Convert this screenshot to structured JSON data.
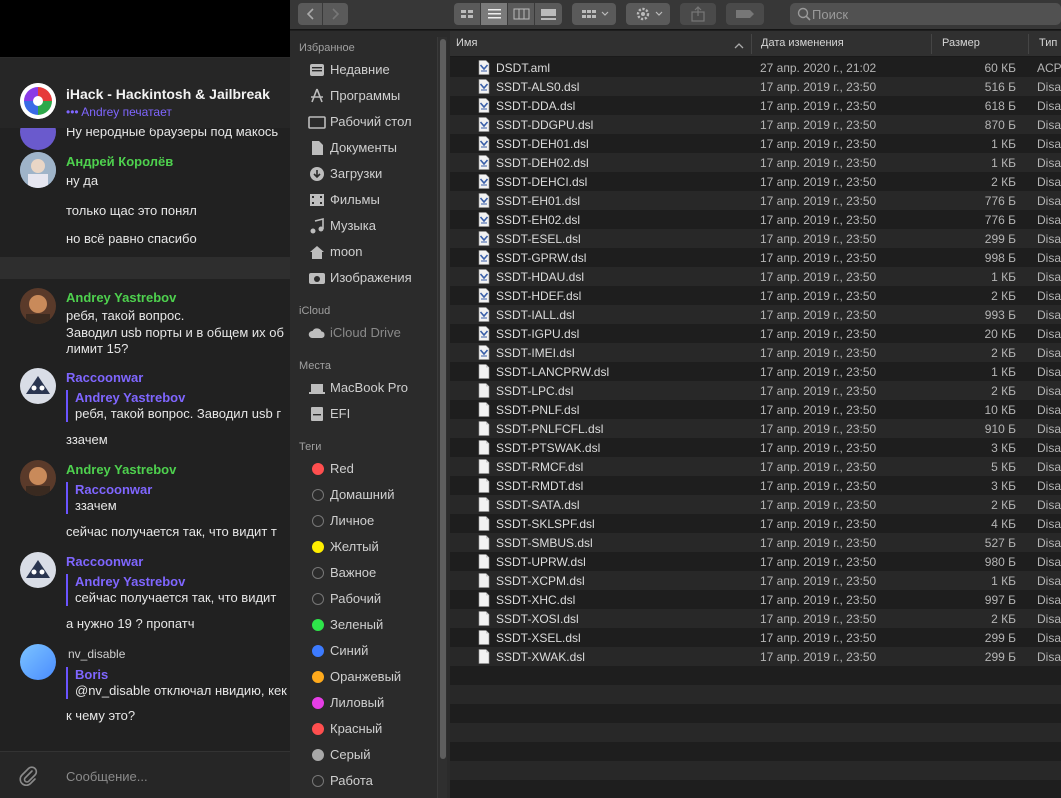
{
  "telegram": {
    "chat_title": "iHack - Hackintosh & Jailbreak",
    "typing_status": "Andrey печатает",
    "input_placeholder": "Сообщение...",
    "colors": {
      "accent": "#7f66ff",
      "green_name": "#4ed14e"
    },
    "messages": {
      "m0_text": "Ну неродные браузеры под макось",
      "m1_name": "Андрей Королёв",
      "m1_text1": "ну да",
      "m1_text2": "только щас это понял",
      "m1_text3": "но всё равно спасибо",
      "m2_name": "Andrey Yastrebov",
      "m2_text1": "ребя, такой вопрос.",
      "m2_text2": "Заводил usb порты и в общем их об",
      "m2_text3": "лимит 15?",
      "m3_name": "Raccoonwar",
      "m3_quote_name": "Andrey Yastrebov",
      "m3_quote_text": "ребя, такой вопрос. Заводил usb г",
      "m3_text": "ззачем",
      "m4_name": "Andrey Yastrebov",
      "m4_quote_name": "Raccoonwar",
      "m4_quote_text": "ззачем",
      "m4_text": "сейчас получается так, что видит т",
      "m5_name": "Raccoonwar",
      "m5_quote_name": "Andrey Yastrebov",
      "m5_quote_text": "сейчас получается так, что видит",
      "m5_text": "а нужно 19 ? пропатч",
      "m6_name": "nv_disable",
      "m6_quote_name": "Boris",
      "m6_quote_text": "@nv_disable отключал нвидию, кек",
      "m6_text": "к чему это?"
    }
  },
  "finder": {
    "search_placeholder": "Поиск",
    "sidebar": {
      "favorites_header": "Избранное",
      "favorites": [
        "Недавние",
        "Программы",
        "Рабочий стол",
        "Документы",
        "Загрузки",
        "Фильмы",
        "Музыка",
        "moon",
        "Изображения"
      ],
      "icloud_header": "iCloud",
      "icloud": [
        "iCloud Drive"
      ],
      "places_header": "Места",
      "places": [
        "MacBook Pro",
        "EFI"
      ],
      "tags_header": "Теги",
      "tags": [
        {
          "label": "Red",
          "color": "#ff4f4f"
        },
        {
          "label": "Домашний",
          "color": ""
        },
        {
          "label": "Личное",
          "color": ""
        },
        {
          "label": "Желтый",
          "color": "#ffee00"
        },
        {
          "label": "Важное",
          "color": ""
        },
        {
          "label": "Рабочий",
          "color": ""
        },
        {
          "label": "Зеленый",
          "color": "#2ee44a"
        },
        {
          "label": "Синий",
          "color": "#3d7bff"
        },
        {
          "label": "Оранжевый",
          "color": "#ffaa1c"
        },
        {
          "label": "Лиловый",
          "color": "#e63ee6"
        },
        {
          "label": "Красный",
          "color": "#ff4f4f"
        },
        {
          "label": "Серый",
          "color": "#a8a8a8"
        },
        {
          "label": "Работа",
          "color": ""
        }
      ]
    },
    "columns": {
      "name": "Имя",
      "date": "Дата изменения",
      "size": "Размер",
      "type": "Тип"
    },
    "files": [
      {
        "name": "DSDT.aml",
        "date": "27 апр. 2020 г., 21:02",
        "size": "60 КБ",
        "type": "ACPI",
        "icon": "aml"
      },
      {
        "name": "SSDT-ALS0.dsl",
        "date": "17 апр. 2019 г., 23:50",
        "size": "516 Б",
        "type": "Disa",
        "icon": "dsl"
      },
      {
        "name": "SSDT-DDA.dsl",
        "date": "17 апр. 2019 г., 23:50",
        "size": "618 Б",
        "type": "Disa",
        "icon": "dsl"
      },
      {
        "name": "SSDT-DDGPU.dsl",
        "date": "17 апр. 2019 г., 23:50",
        "size": "870 Б",
        "type": "Disa",
        "icon": "dsl"
      },
      {
        "name": "SSDT-DEH01.dsl",
        "date": "17 апр. 2019 г., 23:50",
        "size": "1 КБ",
        "type": "Disa",
        "icon": "dsl"
      },
      {
        "name": "SSDT-DEH02.dsl",
        "date": "17 апр. 2019 г., 23:50",
        "size": "1 КБ",
        "type": "Disa",
        "icon": "dsl"
      },
      {
        "name": "SSDT-DEHCI.dsl",
        "date": "17 апр. 2019 г., 23:50",
        "size": "2 КБ",
        "type": "Disa",
        "icon": "dsl"
      },
      {
        "name": "SSDT-EH01.dsl",
        "date": "17 апр. 2019 г., 23:50",
        "size": "776 Б",
        "type": "Disa",
        "icon": "dsl"
      },
      {
        "name": "SSDT-EH02.dsl",
        "date": "17 апр. 2019 г., 23:50",
        "size": "776 Б",
        "type": "Disa",
        "icon": "dsl"
      },
      {
        "name": "SSDT-ESEL.dsl",
        "date": "17 апр. 2019 г., 23:50",
        "size": "299 Б",
        "type": "Disa",
        "icon": "dsl"
      },
      {
        "name": "SSDT-GPRW.dsl",
        "date": "17 апр. 2019 г., 23:50",
        "size": "998 Б",
        "type": "Disa",
        "icon": "dsl"
      },
      {
        "name": "SSDT-HDAU.dsl",
        "date": "17 апр. 2019 г., 23:50",
        "size": "1 КБ",
        "type": "Disa",
        "icon": "dsl"
      },
      {
        "name": "SSDT-HDEF.dsl",
        "date": "17 апр. 2019 г., 23:50",
        "size": "2 КБ",
        "type": "Disa",
        "icon": "dsl"
      },
      {
        "name": "SSDT-IALL.dsl",
        "date": "17 апр. 2019 г., 23:50",
        "size": "993 Б",
        "type": "Disa",
        "icon": "dsl"
      },
      {
        "name": "SSDT-IGPU.dsl",
        "date": "17 апр. 2019 г., 23:50",
        "size": "20 КБ",
        "type": "Disa",
        "icon": "dsl"
      },
      {
        "name": "SSDT-IMEI.dsl",
        "date": "17 апр. 2019 г., 23:50",
        "size": "2 КБ",
        "type": "Disa",
        "icon": "dsl"
      },
      {
        "name": "SSDT-LANCPRW.dsl",
        "date": "17 апр. 2019 г., 23:50",
        "size": "1 КБ",
        "type": "Disa",
        "icon": "doc"
      },
      {
        "name": "SSDT-LPC.dsl",
        "date": "17 апр. 2019 г., 23:50",
        "size": "2 КБ",
        "type": "Disa",
        "icon": "doc"
      },
      {
        "name": "SSDT-PNLF.dsl",
        "date": "17 апр. 2019 г., 23:50",
        "size": "10 КБ",
        "type": "Disa",
        "icon": "doc"
      },
      {
        "name": "SSDT-PNLFCFL.dsl",
        "date": "17 апр. 2019 г., 23:50",
        "size": "910 Б",
        "type": "Disa",
        "icon": "doc"
      },
      {
        "name": "SSDT-PTSWAK.dsl",
        "date": "17 апр. 2019 г., 23:50",
        "size": "3 КБ",
        "type": "Disa",
        "icon": "doc"
      },
      {
        "name": "SSDT-RMCF.dsl",
        "date": "17 апр. 2019 г., 23:50",
        "size": "5 КБ",
        "type": "Disa",
        "icon": "doc"
      },
      {
        "name": "SSDT-RMDT.dsl",
        "date": "17 апр. 2019 г., 23:50",
        "size": "3 КБ",
        "type": "Disa",
        "icon": "doc"
      },
      {
        "name": "SSDT-SATA.dsl",
        "date": "17 апр. 2019 г., 23:50",
        "size": "2 КБ",
        "type": "Disa",
        "icon": "doc"
      },
      {
        "name": "SSDT-SKLSPF.dsl",
        "date": "17 апр. 2019 г., 23:50",
        "size": "4 КБ",
        "type": "Disa",
        "icon": "doc"
      },
      {
        "name": "SSDT-SMBUS.dsl",
        "date": "17 апр. 2019 г., 23:50",
        "size": "527 Б",
        "type": "Disa",
        "icon": "doc"
      },
      {
        "name": "SSDT-UPRW.dsl",
        "date": "17 апр. 2019 г., 23:50",
        "size": "980 Б",
        "type": "Disa",
        "icon": "doc"
      },
      {
        "name": "SSDT-XCPM.dsl",
        "date": "17 апр. 2019 г., 23:50",
        "size": "1 КБ",
        "type": "Disa",
        "icon": "doc"
      },
      {
        "name": "SSDT-XHC.dsl",
        "date": "17 апр. 2019 г., 23:50",
        "size": "997 Б",
        "type": "Disa",
        "icon": "doc"
      },
      {
        "name": "SSDT-XOSI.dsl",
        "date": "17 апр. 2019 г., 23:50",
        "size": "2 КБ",
        "type": "Disa",
        "icon": "doc"
      },
      {
        "name": "SSDT-XSEL.dsl",
        "date": "17 апр. 2019 г., 23:50",
        "size": "299 Б",
        "type": "Disa",
        "icon": "doc"
      },
      {
        "name": "SSDT-XWAK.dsl",
        "date": "17 апр. 2019 г., 23:50",
        "size": "299 Б",
        "type": "Disa",
        "icon": "doc"
      }
    ]
  }
}
